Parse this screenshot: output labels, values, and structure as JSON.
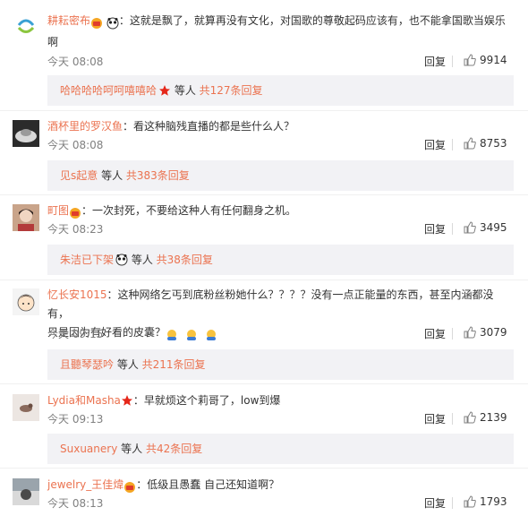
{
  "comments": [
    {
      "user": "耕耘密布",
      "text": "：这就是飘了，就算再没有文化，对国歌的尊敬起码应该有，也不能拿国歌当娱乐",
      "text2": "啊",
      "time": "今天 08:08",
      "reply": "回复",
      "likes": "9914",
      "sub_user": "哈哈哈哈呵呵嘻嘻哈",
      "sub_mid": " 等人 ",
      "sub_count": "共127条回复"
    },
    {
      "user": "酒杯里的罗汉鱼",
      "text": "：看这种脑残直播的都是些什么人？",
      "time": "今天 08:08",
      "reply": "回复",
      "likes": "8753",
      "sub_user": "见s起意",
      "sub_mid": " 等人 ",
      "sub_count": "共383条回复"
    },
    {
      "user": "町图",
      "text": "：一次封死，不要给这种人有任何翻身之机。",
      "time": "今天 08:23",
      "reply": "回复",
      "likes": "3495",
      "sub_user": "朱洁已下架",
      "sub_mid": " 等人 ",
      "sub_count": "共38条回复"
    },
    {
      "user": "忆长安1015",
      "text": "：这种网络乞丐到底粉丝粉她什么？？？？没有一点正能量的东西，甚至内涵都没有，",
      "text2": "只是因为有好看的皮囊？",
      "time": "今天 09:15",
      "reply": "回复",
      "likes": "3079",
      "sub_user": "且聽琴瑟吟",
      "sub_mid": " 等人 ",
      "sub_count": "共211条回复"
    },
    {
      "user": "Lydia和Masha",
      "text": "：早就烦这个莉哥了，low到爆",
      "time": "今天 09:13",
      "reply": "回复",
      "likes": "2139",
      "sub_user": "Suxuanery",
      "sub_mid": " 等人 ",
      "sub_count": "共42条回复"
    },
    {
      "user": "jewelry_王佳煒",
      "text": "：低级且愚蠢  自己还知道啊？",
      "time": "今天 08:13",
      "reply": "回复",
      "likes": "1793"
    }
  ],
  "icons": {
    "like": "thumbs-up-icon",
    "vip": "vip-badge-icon",
    "panda": "panda-emoji-icon",
    "star": "red-star-icon",
    "hug": "hug-emoji-icon"
  },
  "colors": {
    "username": "#eb7350",
    "text": "#333333",
    "time": "#808080",
    "sub_bg": "#f2f2f5"
  }
}
